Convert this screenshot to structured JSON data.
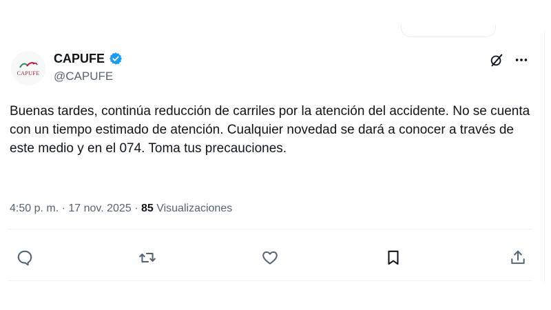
{
  "tweet": {
    "avatar_text": "CAPUFE",
    "display_name": "CAPUFE",
    "handle": "@CAPUFE",
    "verified": true,
    "text": "Buenas tardes, continúa reducción de carriles por la atención del accidente. No se cuenta con un tiempo estimado de atención. Cualquier novedad se dará a conocer a través de este medio y en el 074. Toma tus precauciones.",
    "time": "4:50 p. m.",
    "separator": "·",
    "date": "17 nov. 2025",
    "views_count": "85",
    "views_label": "Visualizaciones"
  },
  "icons": {
    "grok": "grok-icon",
    "more": "more-options-icon",
    "reply": "reply-icon",
    "retweet": "retweet-icon",
    "like": "like-icon",
    "bookmark": "bookmark-icon",
    "share": "share-icon"
  },
  "colors": {
    "text": "#0f1419",
    "secondary": "#536471",
    "verified": "#1d9bf0",
    "divider": "#eff3f4"
  }
}
